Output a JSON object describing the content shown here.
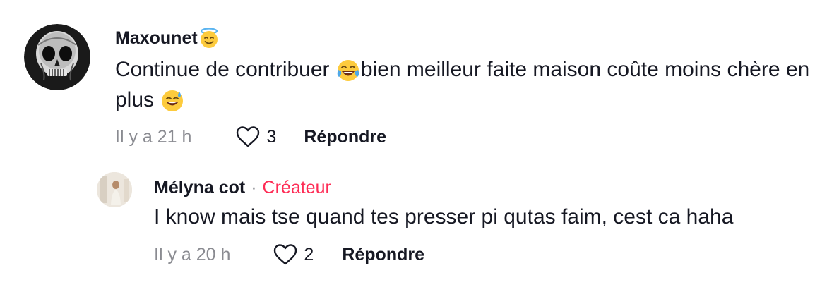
{
  "comment": {
    "username": "Maxounet",
    "username_emoji": "smiling-face-with-halo-icon",
    "text_part1": "Continue de contribuer ",
    "text_emoji1": "tears-of-joy-icon",
    "text_part2": "bien meilleur faite maison coûte moins chère en plus ",
    "text_emoji2": "grinning-face-with-sweat-icon",
    "time": "Il y a 21 h",
    "likes": "3",
    "reply_label": "Répondre"
  },
  "reply": {
    "username": "Mélyna cot",
    "separator": "·",
    "badge": "Créateur",
    "text": "I know mais tse quand tes presser pi qutas faim, cest ca haha",
    "time": "Il y a 20 h",
    "likes": "2",
    "reply_label": "Répondre"
  },
  "colors": {
    "text": "#161823",
    "muted": "#8a8b91",
    "creator_badge": "#fe2c55"
  }
}
